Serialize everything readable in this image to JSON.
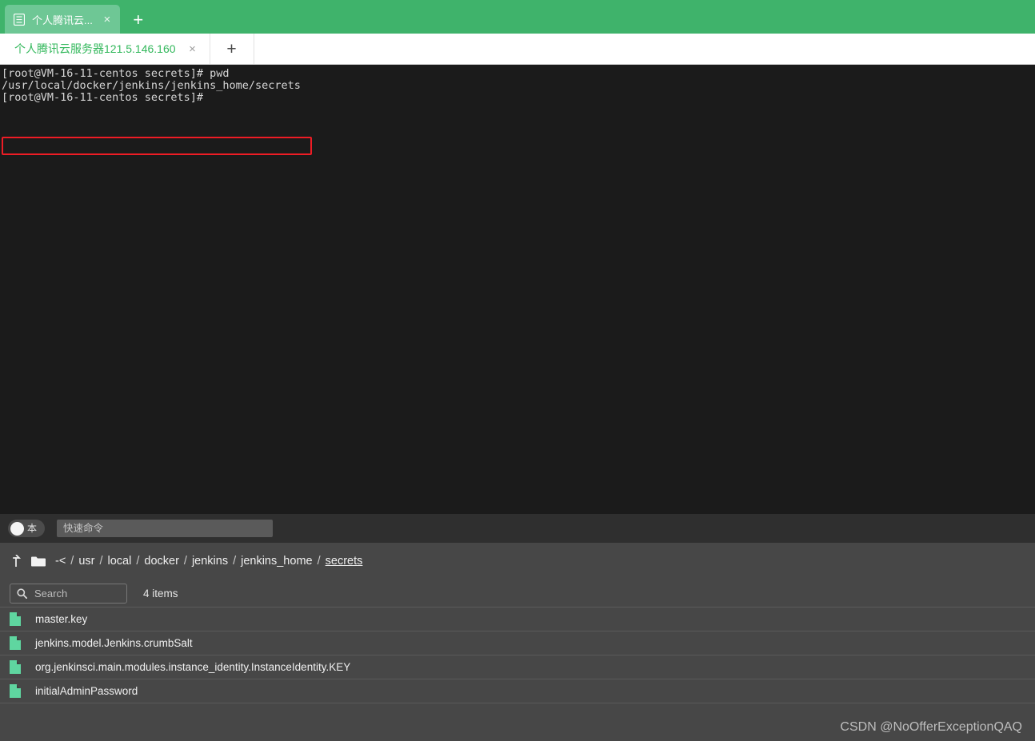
{
  "app_tabs": {
    "tabs": [
      {
        "favicon": "document-icon",
        "title": "个人腾讯云...",
        "close": "×"
      }
    ],
    "new_tab_label": "+"
  },
  "session_tabs": {
    "tabs": [
      {
        "title": "个人腾讯云服务器121.5.146.160",
        "close": "×"
      }
    ],
    "new_tab_label": "+"
  },
  "terminal": {
    "lines": [
      "[root@VM-16-11-centos secrets]# pwd",
      "/usr/local/docker/jenkins/jenkins_home/secrets",
      "[root@VM-16-11-centos secrets]#"
    ],
    "highlight_color": "#ee1c25",
    "background": "#1b1b1b",
    "text_color": "#d6d6d6"
  },
  "quick_command": {
    "toggle_label": "本",
    "placeholder": "快速命令",
    "value": ""
  },
  "file_panel": {
    "breadcrumb": {
      "up_icon": "arrow-up-icon",
      "folder_icon": "folder-icon",
      "root": "-<",
      "separator": "/",
      "segments": [
        "usr",
        "local",
        "docker",
        "jenkins",
        "jenkins_home",
        "secrets"
      ]
    },
    "search": {
      "icon": "search-icon",
      "placeholder": "Search",
      "value": ""
    },
    "item_count": "4 items",
    "files": [
      {
        "icon": "file-icon",
        "name": "master.key"
      },
      {
        "icon": "file-icon",
        "name": "jenkins.model.Jenkins.crumbSalt"
      },
      {
        "icon": "file-icon",
        "name": "org.jenkinsci.main.modules.instance_identity.InstanceIdentity.KEY"
      },
      {
        "icon": "file-icon",
        "name": "initialAdminPassword"
      }
    ],
    "file_icon_color": "#5fd6a0",
    "background": "#474747"
  },
  "watermark": "CSDN @NoOfferExceptionQAQ",
  "colors": {
    "brand_green": "#3fb36b",
    "tab_green_active": "#6ec795",
    "session_tab_text": "#33b85c"
  }
}
